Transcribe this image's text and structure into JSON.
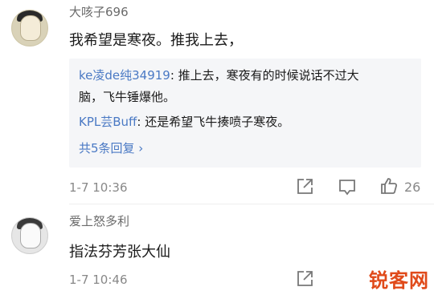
{
  "comments": [
    {
      "username": "大咳子696",
      "text": "我希望是寒夜。推我上去，",
      "time": "1-7 10:36",
      "likes": "26",
      "replies": [
        {
          "name": "ke凌de纯34919",
          "text": ": 推上去，寒夜有的时候说话不过大"
        },
        {
          "name": "",
          "text": "脑，飞牛锤爆他。"
        },
        {
          "name": "KPL芸Buff",
          "text": ": 还是希望飞牛揍喷子寒夜。"
        }
      ],
      "more_replies": "共5条回复 ›"
    },
    {
      "username": "爱上怒多利",
      "text": "指法芬芳张大仙",
      "time": "1-7 10:46"
    }
  ],
  "watermark": "锐客网"
}
